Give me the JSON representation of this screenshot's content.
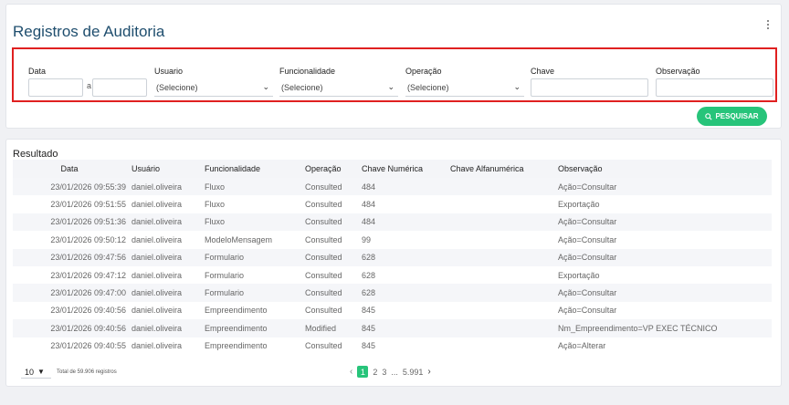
{
  "page": {
    "title": "Registros de Auditoria"
  },
  "filters": {
    "data_label": "Data",
    "data_sep": "a",
    "usuario_label": "Usuario",
    "usuario_value": "(Selecione)",
    "funcionalidade_label": "Funcionalidade",
    "funcionalidade_value": "(Selecione)",
    "operacao_label": "Operação",
    "operacao_value": "(Selecione)",
    "chave_label": "Chave",
    "observacao_label": "Observação"
  },
  "search_button": {
    "label": "PESQUISAR",
    "color": "#27c47a"
  },
  "results": {
    "title": "Resultado",
    "columns": [
      "Data",
      "Usuário",
      "Funcionalidade",
      "Operação",
      "Chave Numérica",
      "Chave Alfanumérica",
      "Observação"
    ],
    "rows": [
      [
        "23/01/2026 09:55:39",
        "daniel.oliveira",
        "Fluxo",
        "Consulted",
        "484",
        "",
        "Ação=Consultar"
      ],
      [
        "23/01/2026 09:51:55",
        "daniel.oliveira",
        "Fluxo",
        "Consulted",
        "484",
        "",
        "Exportação"
      ],
      [
        "23/01/2026 09:51:36",
        "daniel.oliveira",
        "Fluxo",
        "Consulted",
        "484",
        "",
        "Ação=Consultar"
      ],
      [
        "23/01/2026 09:50:12",
        "daniel.oliveira",
        "ModeloMensagem",
        "Consulted",
        "99",
        "",
        "Ação=Consultar"
      ],
      [
        "23/01/2026 09:47:56",
        "daniel.oliveira",
        "Formulario",
        "Consulted",
        "628",
        "",
        "Ação=Consultar"
      ],
      [
        "23/01/2026 09:47:12",
        "daniel.oliveira",
        "Formulario",
        "Consulted",
        "628",
        "",
        "Exportação"
      ],
      [
        "23/01/2026 09:47:00",
        "daniel.oliveira",
        "Formulario",
        "Consulted",
        "628",
        "",
        "Ação=Consultar"
      ],
      [
        "23/01/2026 09:40:56",
        "daniel.oliveira",
        "Empreendimento",
        "Consulted",
        "845",
        "",
        "Ação=Consultar"
      ],
      [
        "23/01/2026 09:40:56",
        "daniel.oliveira",
        "Empreendimento",
        "Modified",
        "845",
        "",
        "Nm_Empreendimento=VP EXEC TÉCNICO"
      ],
      [
        "23/01/2026 09:40:55",
        "daniel.oliveira",
        "Empreendimento",
        "Consulted",
        "845",
        "",
        "Ação=Alterar"
      ]
    ]
  },
  "pagination": {
    "page_size": "10",
    "total": "Total de 59.906 registros",
    "current": "1",
    "pages": [
      "2",
      "3"
    ],
    "ellipsis": "...",
    "last": "5.991",
    "prev_icon": "chevron-left-icon",
    "next_icon": "chevron-right-icon"
  }
}
